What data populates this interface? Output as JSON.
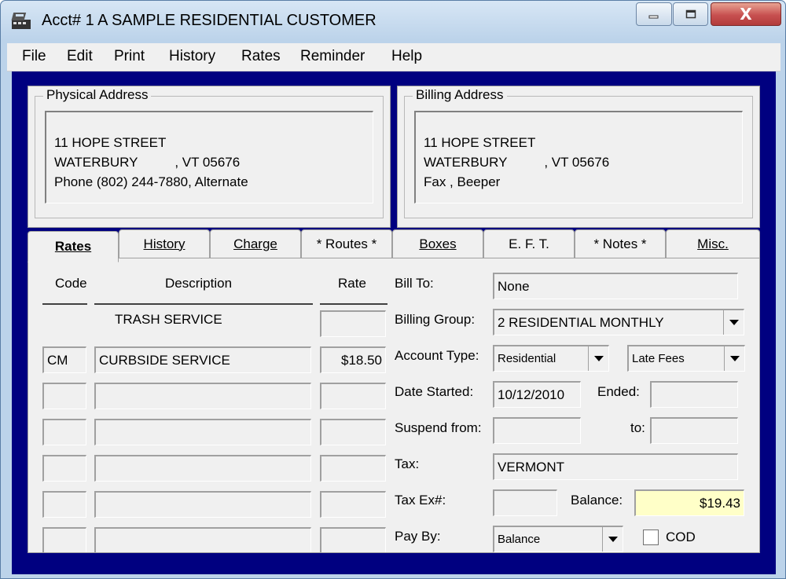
{
  "window": {
    "title": "Acct#  1 A SAMPLE RESIDENTIAL CUSTOMER",
    "icon": "cash-register-icon",
    "controls": {
      "minimize": "minimize-icon",
      "maximize": "maximize-icon",
      "close": "X"
    }
  },
  "menu": {
    "items": [
      "File",
      "Edit",
      "Print",
      "History",
      "Rates",
      "Reminder",
      "Help"
    ]
  },
  "physical_address": {
    "legend": "Physical Address",
    "line1": "11 HOPE STREET",
    "line2": "WATERBURY          , VT 05676",
    "line3": "Phone (802) 244-7880, Alternate"
  },
  "billing_address": {
    "legend": "Billing Address",
    "line1": "11 HOPE STREET",
    "line2": "WATERBURY          , VT 05676",
    "line3": "Fax , Beeper"
  },
  "tabs": [
    "Rates",
    "History",
    "Charge",
    "* Routes *",
    "Boxes",
    "E. F. T.",
    "* Notes *",
    "Misc."
  ],
  "rates": {
    "headers": {
      "code": "Code",
      "description": "Description",
      "rate": "Rate"
    },
    "section_title": "TRASH SERVICE",
    "rows": [
      {
        "code": "CM",
        "description": "CURBSIDE SERVICE",
        "rate": "$18.50"
      },
      {
        "code": "",
        "description": "",
        "rate": ""
      },
      {
        "code": "",
        "description": "",
        "rate": ""
      },
      {
        "code": "",
        "description": "",
        "rate": ""
      },
      {
        "code": "",
        "description": "",
        "rate": ""
      },
      {
        "code": "",
        "description": "",
        "rate": ""
      }
    ]
  },
  "account": {
    "bill_to_label": "Bill To:",
    "bill_to_value": "None",
    "billing_group_label": "Billing Group:",
    "billing_group_value": "2  RESIDENTIAL MONTHLY",
    "account_type_label": "Account Type:",
    "account_type_value": "Residential",
    "late_fees_value": "Late Fees",
    "date_started_label": "Date Started:",
    "date_started_value": "10/12/2010",
    "ended_label": "Ended:",
    "ended_value": "",
    "suspend_from_label": "Suspend from:",
    "suspend_from_value": "",
    "suspend_to_label": "to:",
    "suspend_to_value": "",
    "tax_label": "Tax:",
    "tax_value": "VERMONT",
    "tax_ex_label": "Tax Ex#:",
    "tax_ex_value": "",
    "balance_label": "Balance:",
    "balance_value": "$19.43",
    "pay_by_label": "Pay By:",
    "pay_by_value": "Balance",
    "cod_label": "COD"
  },
  "colors": {
    "client_background": "#000080",
    "balance_background": "#ffffc8",
    "close_button": "#c75050"
  }
}
